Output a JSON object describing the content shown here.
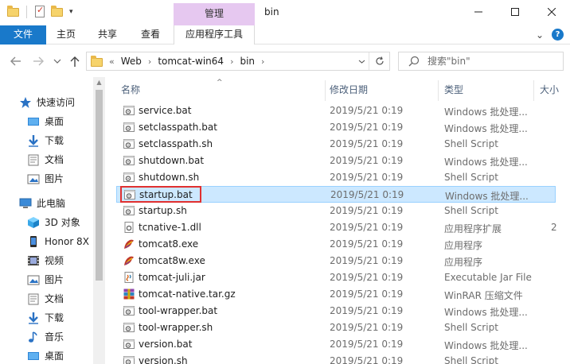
{
  "titlebar": {
    "context_tab_header": "管理",
    "window_title": "bin",
    "minimize_glyph": "—",
    "maximize_glyph": "☐",
    "close_glyph": "✕"
  },
  "ribbon": {
    "tabs": [
      "文件",
      "主页",
      "共享",
      "查看",
      "应用程序工具"
    ],
    "expand_glyph": "⌄",
    "help_glyph": "?"
  },
  "address": {
    "overflow": "«",
    "crumbs": [
      "Web",
      "tomcat-win64",
      "bin"
    ],
    "sep": "›",
    "search_placeholder": "搜索\"bin\""
  },
  "sidebar": {
    "items": [
      {
        "label": "快速访问",
        "icon": "star-icon",
        "pinned": false
      },
      {
        "label": "桌面",
        "icon": "desktop-icon",
        "pinned": true
      },
      {
        "label": "下载",
        "icon": "download-icon",
        "pinned": true
      },
      {
        "label": "文档",
        "icon": "document-icon",
        "pinned": true
      },
      {
        "label": "图片",
        "icon": "pictures-icon",
        "pinned": true
      },
      {
        "label": "此电脑",
        "icon": "computer-icon",
        "pinned": false
      },
      {
        "label": "3D 对象",
        "icon": "cube-icon",
        "pinned": false
      },
      {
        "label": "Honor 8X",
        "icon": "phone-icon",
        "pinned": false
      },
      {
        "label": "视频",
        "icon": "video-icon",
        "pinned": false
      },
      {
        "label": "图片",
        "icon": "pictures-icon",
        "pinned": false
      },
      {
        "label": "文档",
        "icon": "document-icon",
        "pinned": false
      },
      {
        "label": "下载",
        "icon": "download-icon",
        "pinned": false
      },
      {
        "label": "音乐",
        "icon": "music-icon",
        "pinned": false
      },
      {
        "label": "桌面",
        "icon": "desktop-icon",
        "pinned": false
      }
    ],
    "pin_glyph": "📌"
  },
  "columns": {
    "name": "名称",
    "date": "修改日期",
    "type": "类型",
    "size": "大小",
    "sort_glyph": "^"
  },
  "files": [
    {
      "name": "service.bat",
      "date": "2019/5/21 0:19",
      "type": "Windows 批处理...",
      "size": "",
      "icon": "batch-file-icon"
    },
    {
      "name": "setclasspath.bat",
      "date": "2019/5/21 0:19",
      "type": "Windows 批处理...",
      "size": "",
      "icon": "batch-file-icon"
    },
    {
      "name": "setclasspath.sh",
      "date": "2019/5/21 0:19",
      "type": "Shell Script",
      "size": "",
      "icon": "script-file-icon"
    },
    {
      "name": "shutdown.bat",
      "date": "2019/5/21 0:19",
      "type": "Windows 批处理...",
      "size": "",
      "icon": "batch-file-icon"
    },
    {
      "name": "shutdown.sh",
      "date": "2019/5/21 0:19",
      "type": "Shell Script",
      "size": "",
      "icon": "script-file-icon"
    },
    {
      "name": "startup.bat",
      "date": "2019/5/21 0:19",
      "type": "Windows 批处理...",
      "size": "",
      "icon": "batch-file-icon",
      "selected": true
    },
    {
      "name": "startup.sh",
      "date": "2019/5/21 0:19",
      "type": "Shell Script",
      "size": "",
      "icon": "script-file-icon"
    },
    {
      "name": "tcnative-1.dll",
      "date": "2019/5/21 0:19",
      "type": "应用程序扩展",
      "size": "2",
      "icon": "dll-file-icon"
    },
    {
      "name": "tomcat8.exe",
      "date": "2019/5/21 0:19",
      "type": "应用程序",
      "size": "",
      "icon": "tomcat-exe-icon"
    },
    {
      "name": "tomcat8w.exe",
      "date": "2019/5/21 0:19",
      "type": "应用程序",
      "size": "",
      "icon": "tomcat-exe-icon"
    },
    {
      "name": "tomcat-juli.jar",
      "date": "2019/5/21 0:19",
      "type": "Executable Jar File",
      "size": "",
      "icon": "jar-file-icon"
    },
    {
      "name": "tomcat-native.tar.gz",
      "date": "2019/5/21 0:19",
      "type": "WinRAR 压缩文件",
      "size": "",
      "icon": "archive-file-icon"
    },
    {
      "name": "tool-wrapper.bat",
      "date": "2019/5/21 0:19",
      "type": "Windows 批处理...",
      "size": "",
      "icon": "batch-file-icon"
    },
    {
      "name": "tool-wrapper.sh",
      "date": "2019/5/21 0:19",
      "type": "Shell Script",
      "size": "",
      "icon": "script-file-icon"
    },
    {
      "name": "version.bat",
      "date": "2019/5/21 0:19",
      "type": "Windows 批处理...",
      "size": "",
      "icon": "batch-file-icon"
    },
    {
      "name": "version.sh",
      "date": "2019/5/21 0:19",
      "type": "Shell Script",
      "size": "",
      "icon": "script-file-icon"
    }
  ],
  "colors": {
    "accent": "#1979ca",
    "context_tab": "#e6c8f0",
    "selection": "#cce8ff",
    "highlight_border": "#e03030"
  }
}
